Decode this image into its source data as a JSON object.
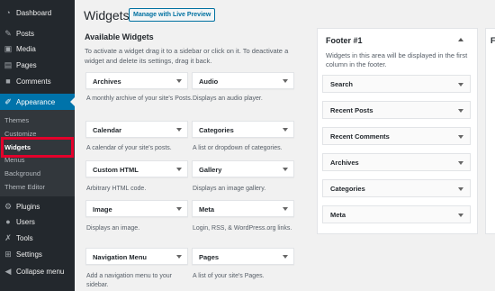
{
  "sidebar": {
    "items": [
      {
        "label": "Dashboard",
        "icon": "dashboard-icon"
      },
      {
        "label": "Posts",
        "icon": "pin-icon"
      },
      {
        "label": "Media",
        "icon": "media-icon"
      },
      {
        "label": "Pages",
        "icon": "pages-icon"
      },
      {
        "label": "Comments",
        "icon": "comments-icon"
      },
      {
        "label": "Appearance",
        "icon": "brush-icon"
      },
      {
        "label": "Plugins",
        "icon": "plugin-icon"
      },
      {
        "label": "Users",
        "icon": "users-icon"
      },
      {
        "label": "Tools",
        "icon": "wrench-icon"
      },
      {
        "label": "Settings",
        "icon": "settings-icon"
      },
      {
        "label": "Collapse menu",
        "icon": "collapse-icon"
      }
    ],
    "submenu": [
      "Themes",
      "Customize",
      "Widgets",
      "Menus",
      "Background",
      "Theme Editor"
    ]
  },
  "header": {
    "title": "Widgets",
    "preview_button": "Manage with Live Preview"
  },
  "available": {
    "title": "Available Widgets",
    "description": "To activate a widget drag it to a sidebar or click on it. To deactivate a widget and delete its settings, drag it back."
  },
  "widgets": [
    {
      "title": "Archives",
      "desc": "A monthly archive of your site's Posts."
    },
    {
      "title": "Audio",
      "desc": "Displays an audio player."
    },
    {
      "title": "Calendar",
      "desc": "A calendar of your site's posts."
    },
    {
      "title": "Categories",
      "desc": "A list or dropdown of categories."
    },
    {
      "title": "Custom HTML",
      "desc": "Arbitrary HTML code."
    },
    {
      "title": "Gallery",
      "desc": "Displays an image gallery."
    },
    {
      "title": "Image",
      "desc": "Displays an image."
    },
    {
      "title": "Meta",
      "desc": "Login, RSS, & WordPress.org links."
    },
    {
      "title": "Navigation Menu",
      "desc": "Add a navigation menu to your sidebar."
    },
    {
      "title": "Pages",
      "desc": "A list of your site's Pages."
    }
  ],
  "footer": {
    "title": "Footer #1",
    "description": "Widgets in this area will be displayed in the first column in the footer.",
    "widgets": [
      "Search",
      "Recent Posts",
      "Recent Comments",
      "Archives",
      "Categories",
      "Meta"
    ]
  },
  "second_panel": {
    "title": "Fo"
  },
  "colors": {
    "sidebar": "#23282d",
    "active": "#0073aa",
    "highlight": "#e4002b"
  }
}
